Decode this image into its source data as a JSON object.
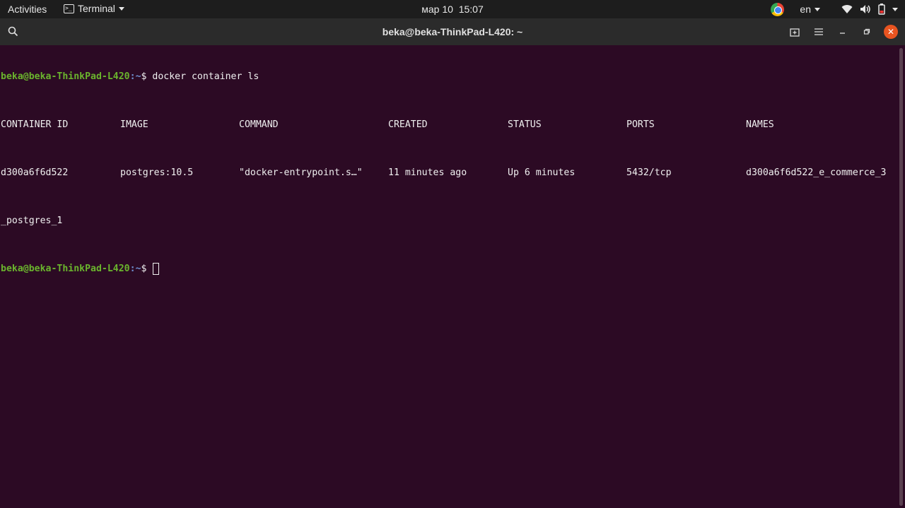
{
  "topbar": {
    "activities": "Activities",
    "app_name": "Terminal",
    "clock_date": "мар 10",
    "clock_time": "15:07",
    "language": "en",
    "icons": [
      "chrome-icon",
      "wifi-icon",
      "volume-icon",
      "battery-icon",
      "power-menu-icon"
    ]
  },
  "window": {
    "title": "beka@beka-ThinkPad-L420: ~",
    "icons": [
      "search-icon",
      "new-tab-icon",
      "hamburger-menu-icon",
      "minimize-icon",
      "restore-icon",
      "close-icon"
    ]
  },
  "terminal": {
    "prompt_user": "beka@beka-ThinkPad-L420",
    "prompt_path": ":~",
    "prompt_symbol": "$ ",
    "command": "docker container ls",
    "headers": [
      "CONTAINER ID",
      "IMAGE",
      "COMMAND",
      "CREATED",
      "STATUS",
      "PORTS",
      "NAMES"
    ],
    "rows": [
      [
        "d300a6f6d522",
        "postgres:10.5",
        "\"docker-entrypoint.s…\"",
        "11 minutes ago",
        "Up 6 minutes",
        "5432/tcp",
        "d300a6f6d522_e_commerce_3"
      ]
    ],
    "wrap_line": "_postgres_1"
  },
  "colors": {
    "terminal_bg": "#2c0a24",
    "prompt_user": "#6ab42d",
    "prompt_path": "#6f8fd0",
    "close_button": "#e95420"
  }
}
